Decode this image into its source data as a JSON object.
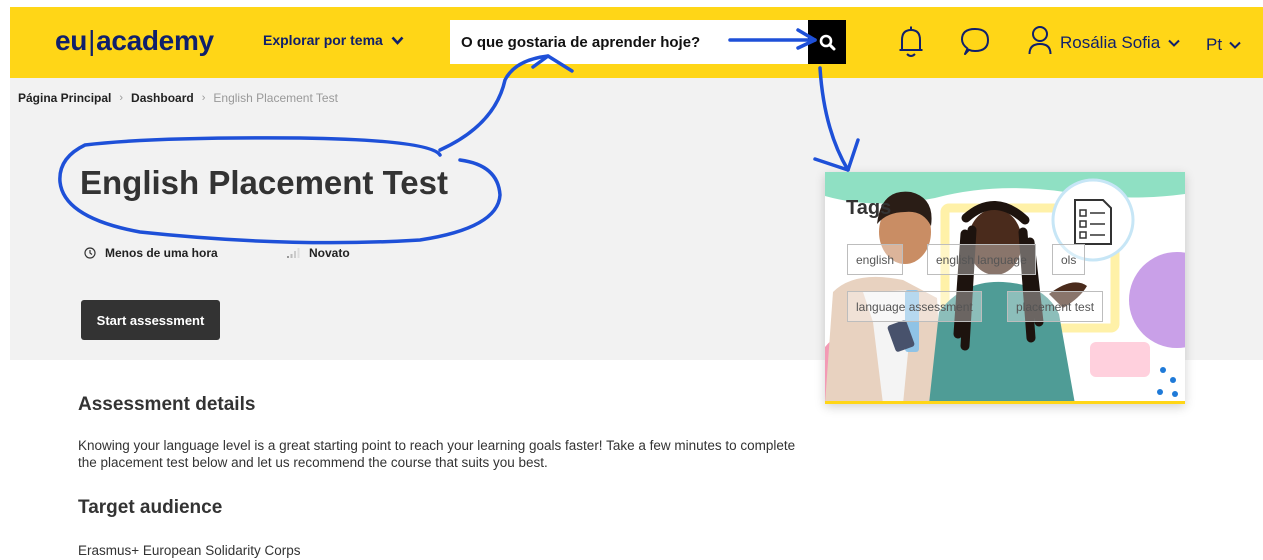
{
  "header": {
    "logo": {
      "part1": "eu",
      "separator": "|",
      "part2": "academy"
    },
    "explore_label": "Explorar por tema",
    "search": {
      "placeholder": "O que gostaria de aprender hoje?"
    },
    "icons": [
      "search-icon",
      "bell-icon",
      "chat-bubble-icon",
      "user-icon",
      "chevron-down-icon"
    ],
    "user_name": "Rosália Sofia",
    "language": "Pt"
  },
  "breadcrumb": {
    "items": [
      "Página Principal",
      "Dashboard"
    ],
    "current": "English Placement Test"
  },
  "course": {
    "title": "English Placement Test",
    "duration": "Menos de uma hora",
    "level": "Novato",
    "start_label": "Start assessment"
  },
  "tags_card": {
    "title": "Tags",
    "tags": [
      "english",
      "english language",
      "ols",
      "language assessment",
      "placement test"
    ]
  },
  "assessment": {
    "heading": "Assessment details",
    "text": "Knowing your language level is a great starting point to reach your learning goals faster! Take a few minutes to complete the placement test below and let us recommend the course that suits you best."
  },
  "audience": {
    "heading": "Target audience",
    "text": "Erasmus+ European Solidarity Corps"
  },
  "colors": {
    "brand_yellow": "#ffd617",
    "brand_navy": "#10206b",
    "annotation_blue": "#1e50d8",
    "button_dark": "#333333",
    "hero_gray": "#f2f2f2"
  }
}
